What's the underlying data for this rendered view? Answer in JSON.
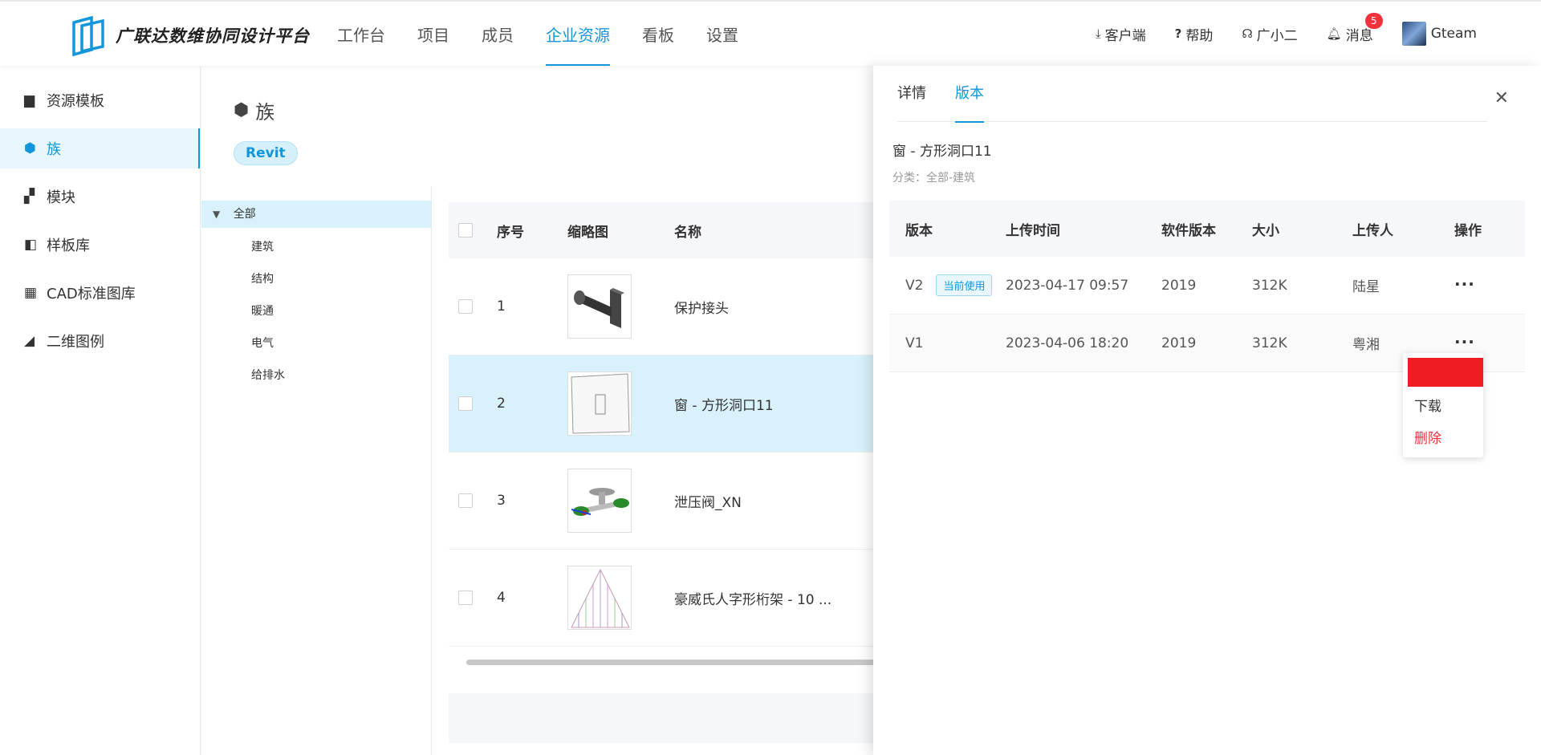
{
  "header": {
    "logo_text": "广联达数维协同设计平台",
    "nav": [
      {
        "label": "工作台"
      },
      {
        "label": "项目"
      },
      {
        "label": "成员"
      },
      {
        "label": "企业资源"
      },
      {
        "label": "看板"
      },
      {
        "label": "设置"
      }
    ],
    "active_nav": "企业资源",
    "right": {
      "client": "客户端",
      "help": "帮助",
      "assistant": "广小二",
      "messages": "消息",
      "message_count": "5",
      "user": "Gteam"
    }
  },
  "sidebar": {
    "items": [
      {
        "label": "资源模板",
        "icon": "template-icon"
      },
      {
        "label": "族",
        "icon": "family-icon"
      },
      {
        "label": "模块",
        "icon": "module-icon"
      },
      {
        "label": "样板库",
        "icon": "sample-library-icon"
      },
      {
        "label": "CAD标准图库",
        "icon": "cad-library-icon"
      },
      {
        "label": "二维图例",
        "icon": "legend-icon"
      }
    ],
    "active": "族"
  },
  "main": {
    "title": "族",
    "platform_tag": "Revit",
    "tree": {
      "root": "全部",
      "children": [
        "建筑",
        "结构",
        "暖通",
        "电气",
        "给排水"
      ]
    },
    "table": {
      "columns": [
        "序号",
        "缩略图",
        "名称"
      ],
      "rows": [
        {
          "index": "1",
          "name": "保护接头"
        },
        {
          "index": "2",
          "name": "窗 - 方形洞口11"
        },
        {
          "index": "3",
          "name": "泄压阀_XN"
        },
        {
          "index": "4",
          "name": "豪威氏人字形桁架 - 10 ..."
        }
      ],
      "selected_index": "2"
    }
  },
  "drawer": {
    "tabs": [
      "详情",
      "版本"
    ],
    "active_tab": "版本",
    "title": "窗 - 方形洞口11",
    "category": "分类：全部-建筑",
    "columns": [
      "版本",
      "上传时间",
      "软件版本",
      "大小",
      "上传人",
      "操作"
    ],
    "versions": [
      {
        "version": "V2",
        "tag": "当前使用",
        "time": "2023-04-17 09:57",
        "software": "2019",
        "size": "312K",
        "uploader": "陆星"
      },
      {
        "version": "V1",
        "tag": "",
        "time": "2023-04-06 18:20",
        "software": "2019",
        "size": "312K",
        "uploader": "粤湘"
      }
    ],
    "menu": {
      "download": "下载",
      "delete": "删除"
    }
  },
  "colors": {
    "accent": "#1296db",
    "danger": "#f5323c",
    "highlight_row": "#d8f1fb"
  }
}
